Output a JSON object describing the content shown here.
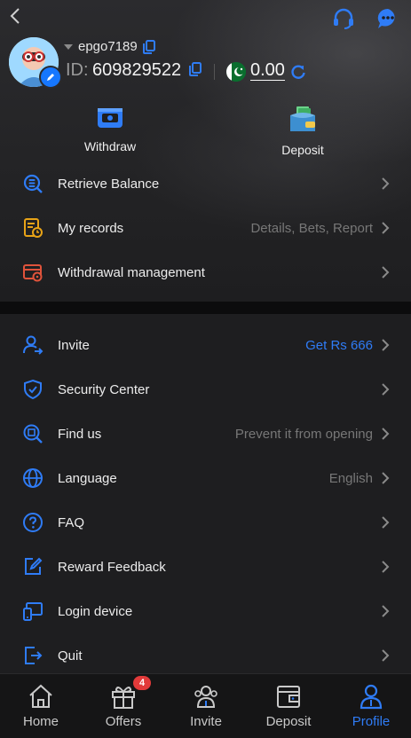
{
  "colors": {
    "accent": "#2f7cf6",
    "background": "#1e1e20",
    "muted_text": "#777777",
    "badge_red": "#e23a3a"
  },
  "header": {
    "back_icon": "chevron-left-icon",
    "support_icon": "headset-icon",
    "chat_icon": "chat-bubble-icon"
  },
  "profile": {
    "username": "epgo7189",
    "id_label": "ID:",
    "id_value": "609829522",
    "currency_flag": "pakistan-flag-icon",
    "balance": "0.00"
  },
  "quick_actions": [
    {
      "label": "Withdraw",
      "icon": "withdraw-icon"
    },
    {
      "label": "Deposit",
      "icon": "wallet-icon"
    }
  ],
  "menu_top": [
    {
      "label": "Retrieve Balance",
      "right": "",
      "icon": "retrieve-balance-icon"
    },
    {
      "label": "My records",
      "right": "Details, Bets, Report",
      "icon": "records-icon"
    },
    {
      "label": "Withdrawal management",
      "right": "",
      "icon": "withdrawal-management-icon"
    }
  ],
  "menu_bottom": [
    {
      "label": "Invite",
      "right": "Get Rs 666",
      "icon": "invite-icon"
    },
    {
      "label": "Security Center",
      "right": "",
      "icon": "shield-icon"
    },
    {
      "label": "Find us",
      "right": "Prevent it from opening",
      "icon": "find-us-icon"
    },
    {
      "label": "Language",
      "right": "English",
      "icon": "globe-icon"
    },
    {
      "label": "FAQ",
      "right": "",
      "icon": "question-icon"
    },
    {
      "label": "Reward Feedback",
      "right": "",
      "icon": "feedback-edit-icon"
    },
    {
      "label": "Login device",
      "right": "",
      "icon": "devices-icon"
    },
    {
      "label": "Quit",
      "right": "",
      "icon": "logout-icon"
    }
  ],
  "tabbar": [
    {
      "label": "Home",
      "icon": "home-icon"
    },
    {
      "label": "Offers",
      "icon": "gift-icon",
      "badge": "4"
    },
    {
      "label": "Invite",
      "icon": "people-icon"
    },
    {
      "label": "Deposit",
      "icon": "wallet-icon"
    },
    {
      "label": "Profile",
      "icon": "profile-icon",
      "active": true
    }
  ]
}
